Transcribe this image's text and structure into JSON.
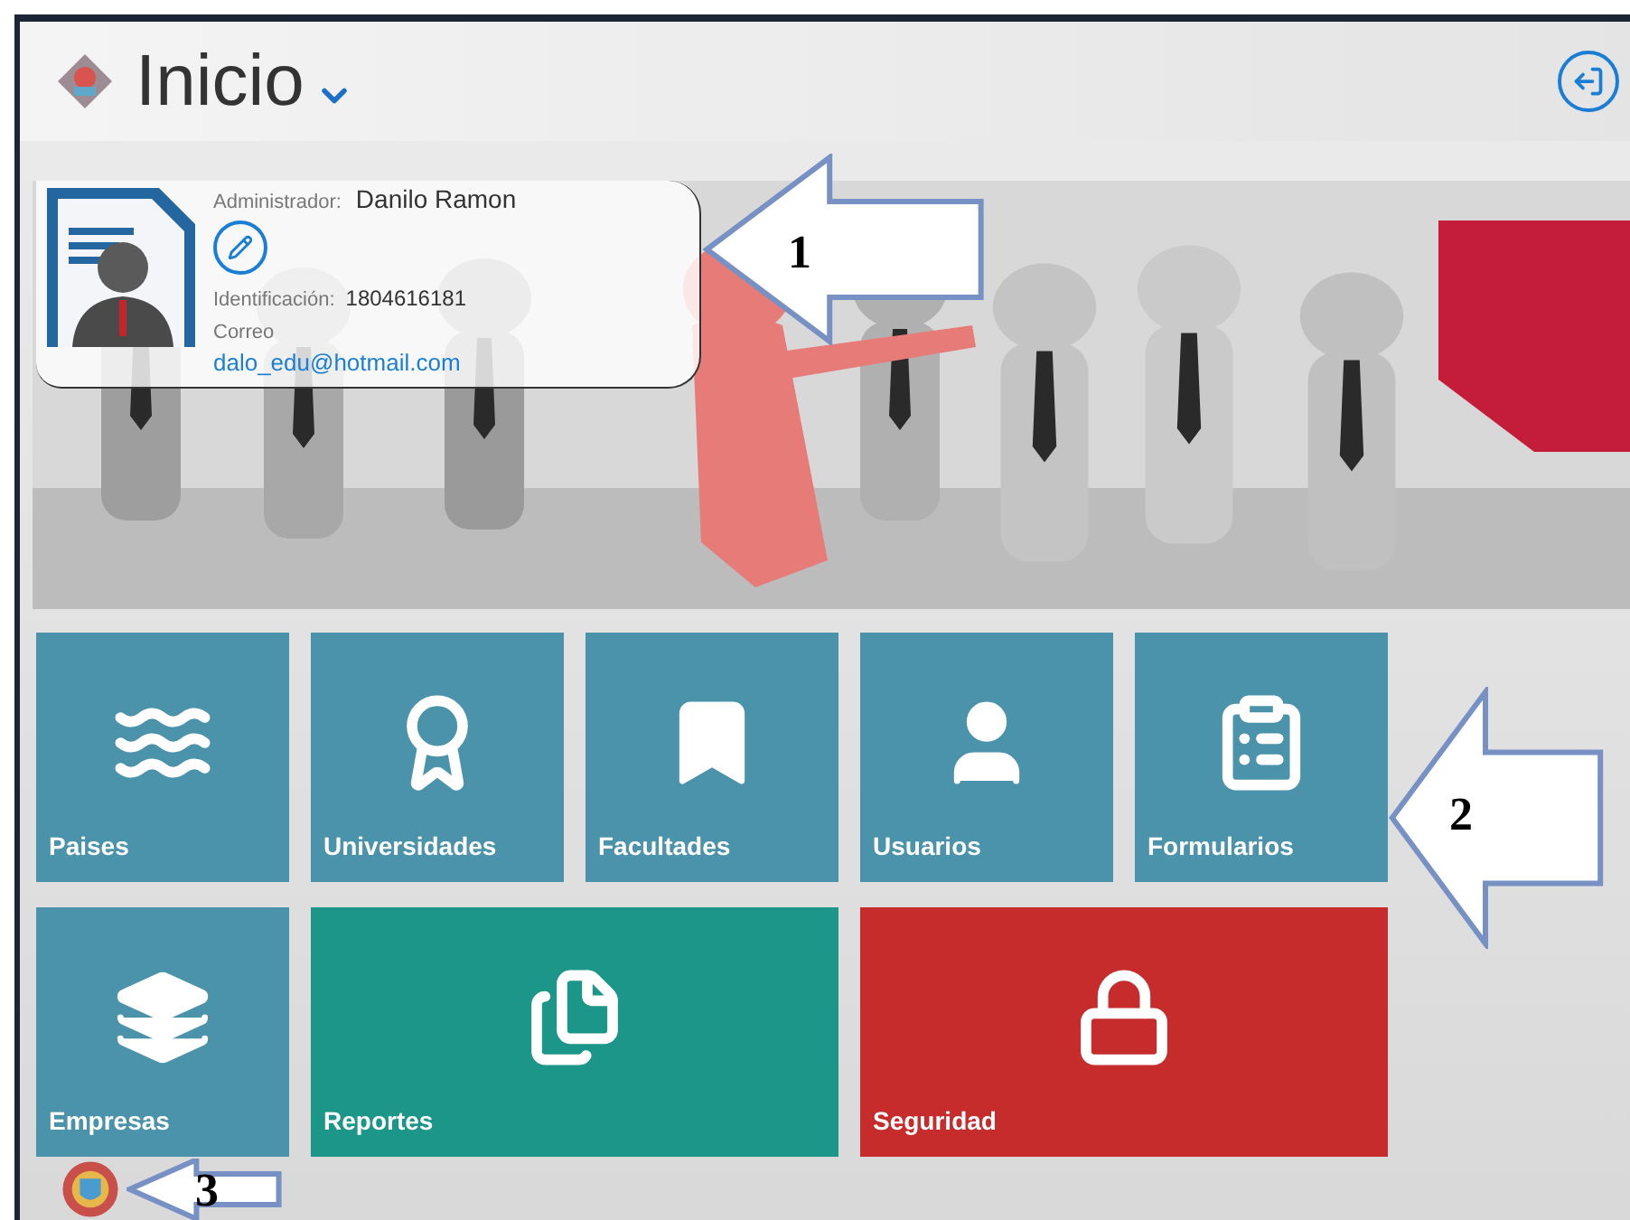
{
  "header": {
    "title": "Inicio"
  },
  "profile": {
    "role_label": "Administrador:",
    "name": "Danilo Ramon",
    "id_label": "Identificación:",
    "id": "1804616181",
    "email_label": "Correo",
    "email": "dalo_edu@hotmail.com"
  },
  "tiles": [
    {
      "label": "Paises",
      "kind": "waves",
      "color": "#4a93ab",
      "wide": false
    },
    {
      "label": "Universidades",
      "kind": "award",
      "color": "#4a93ab",
      "wide": false
    },
    {
      "label": "Facultades",
      "kind": "bookmark",
      "color": "#4a93ab",
      "wide": false
    },
    {
      "label": "Usuarios",
      "kind": "user",
      "color": "#4a93ab",
      "wide": false
    },
    {
      "label": "Formularios",
      "kind": "clipboard",
      "color": "#4a93ab",
      "wide": false
    },
    {
      "label": "Empresas",
      "kind": "layers",
      "color": "#4a93ab",
      "wide": false
    },
    {
      "label": "Reportes",
      "kind": "files",
      "color": "#1b9688",
      "wide": true
    },
    {
      "label": "Seguridad",
      "kind": "lock",
      "color": "#c62c2c",
      "wide": true
    }
  ],
  "callouts": [
    {
      "label": "1"
    },
    {
      "label": "2"
    },
    {
      "label": "3"
    }
  ]
}
